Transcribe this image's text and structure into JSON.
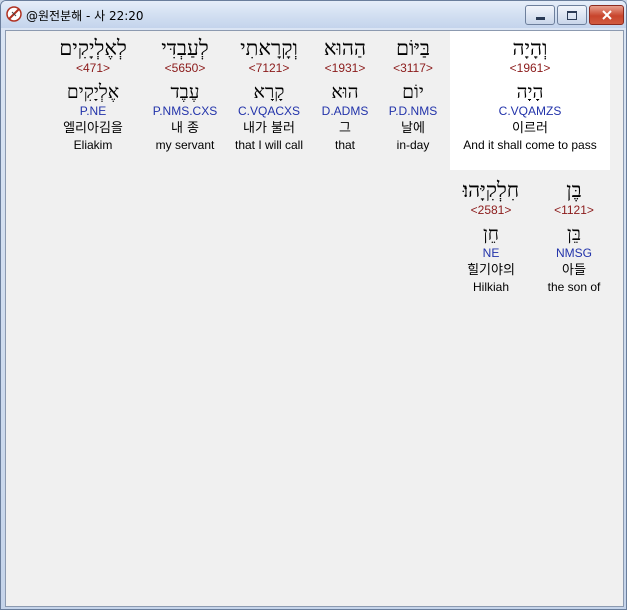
{
  "window": {
    "title": "@원전분해 - 사 22:20",
    "icon": "app-compass-icon",
    "controls": [
      "minimize-icon",
      "maximize-icon",
      "close-icon"
    ]
  },
  "words": [
    {
      "hebrew": "וְהָיָה",
      "strong": "<1961>",
      "lemma": "הָיָה",
      "morph": "C.VQAMZS",
      "korean": "이르러",
      "english": "And it shall come to pass",
      "highlighted": true
    },
    {
      "hebrew": "בַּיּוֹם",
      "strong": "<3117>",
      "lemma": "יוֹם",
      "morph": "P.D.NMS",
      "korean": "날에",
      "english": "in-day"
    },
    {
      "hebrew": "הַהוּא",
      "strong": "<1931>",
      "lemma": "הוּא",
      "morph": "D.ADMS",
      "korean": "그",
      "english": "that"
    },
    {
      "hebrew": "וְקָרָאתִי",
      "strong": "<7121>",
      "lemma": "קָרָא",
      "morph": "C.VQACXS",
      "korean": "내가 불러",
      "english": "that I will call"
    },
    {
      "hebrew": "לְעַבְדִּי",
      "strong": "<5650>",
      "lemma": "עֶבֶד",
      "morph": "P.NMS.CXS",
      "korean": "내 종",
      "english": "my servant"
    },
    {
      "hebrew": "לְאֶלְיָקִים",
      "strong": "<471>",
      "lemma": "אֶלְיָקִים",
      "morph": "P.NE",
      "korean": "엘리아김을",
      "english": "Eliakim"
    },
    {
      "hebrew": "בֶּן",
      "strong": "<1121>",
      "lemma": "בֵּן",
      "morph": "NMSG",
      "korean": "아들",
      "english": "the son of"
    },
    {
      "hebrew": "חִלְקִיָּהוּ׃",
      "strong": "<2581>",
      "lemma": "חֵן",
      "morph": "NE",
      "korean": "힐기야의",
      "english": "Hilkiah"
    }
  ]
}
